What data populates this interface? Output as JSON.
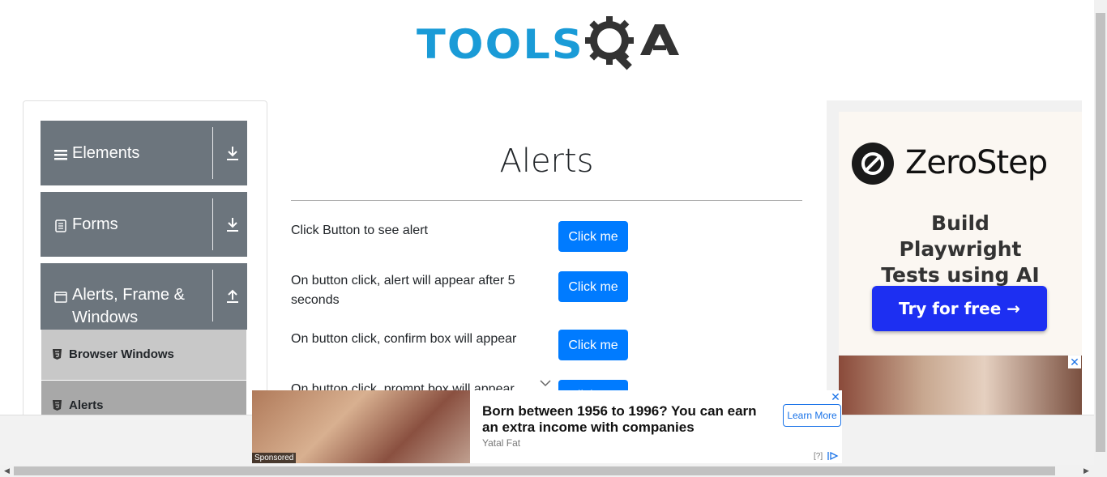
{
  "logo": {
    "text_left": "TOOLS",
    "text_right": "QA"
  },
  "sidebar": {
    "groups": [
      {
        "label": "Elements",
        "icon": "hamburger-icon",
        "arrow": "download-arrow-icon"
      },
      {
        "label": "Forms",
        "icon": "document-icon",
        "arrow": "download-arrow-icon"
      },
      {
        "label": "Alerts, Frame & Windows",
        "icon": "window-icon",
        "arrow": "upload-arrow-icon"
      }
    ],
    "subitems": [
      {
        "label": "Browser Windows",
        "icon": "html5-icon"
      },
      {
        "label": "Alerts",
        "icon": "html5-icon"
      }
    ]
  },
  "main": {
    "title": "Alerts",
    "rows": [
      {
        "text": "Click Button to see alert",
        "button": "Click me"
      },
      {
        "text": "On button click, alert will appear after 5 seconds",
        "button": "Click me"
      },
      {
        "text": "On button click, confirm box will appear",
        "button": "Click me"
      },
      {
        "text": "On button click, prompt box will appear",
        "button": "Click me"
      }
    ]
  },
  "ad_right": {
    "brand": "ZeroStep",
    "tagline": "Build Playwright Tests using AI",
    "cta": "Try for free →",
    "close": "✕"
  },
  "ad_bottom": {
    "headline": "Born between 1956 to 1996? You can earn an extra income with companies",
    "source": "Yatal Fat",
    "cta": "Learn More",
    "sponsored": "Sponsored",
    "close": "✕",
    "info": "[?]"
  },
  "colors": {
    "primary": "#007bff",
    "sidebar_group": "#6c757d",
    "subitem": "#c8c8c8",
    "logo_blue": "#1a9bd7",
    "ad_cta": "#1d2ff2"
  }
}
